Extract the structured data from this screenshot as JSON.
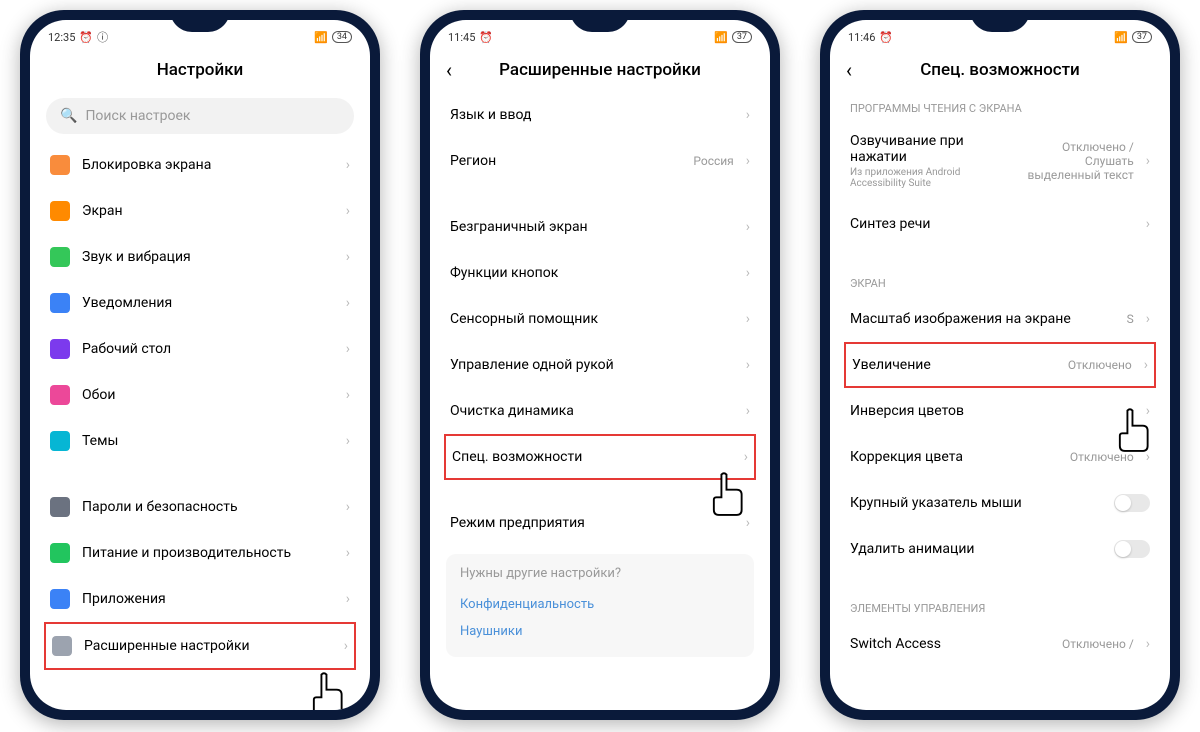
{
  "phone1": {
    "time": "12:35",
    "battery": "34",
    "title": "Настройки",
    "search_placeholder": "Поиск настроек",
    "items": [
      {
        "label": "Блокировка экрана",
        "color": "#f98c3c"
      },
      {
        "label": "Экран",
        "color": "#ff8a00"
      },
      {
        "label": "Звук и вибрация",
        "color": "#34c759"
      },
      {
        "label": "Уведомления",
        "color": "#3b82f6"
      },
      {
        "label": "Рабочий стол",
        "color": "#7c3aed"
      },
      {
        "label": "Обои",
        "color": "#ec4899"
      },
      {
        "label": "Темы",
        "color": "#06b6d4"
      }
    ],
    "items2": [
      {
        "label": "Пароли и безопасность",
        "color": "#6b7280"
      },
      {
        "label": "Питание и производительность",
        "color": "#22c55e"
      },
      {
        "label": "Приложения",
        "color": "#3b82f6"
      },
      {
        "label": "Расширенные настройки",
        "color": "#9ca3af",
        "highlight": true
      }
    ]
  },
  "phone2": {
    "time": "11:45",
    "battery": "37",
    "title": "Расширенные настройки",
    "items": [
      {
        "label": "Язык и ввод"
      },
      {
        "label": "Регион",
        "value": "Россия"
      }
    ],
    "items2": [
      {
        "label": "Безграничный экран"
      },
      {
        "label": "Функции кнопок"
      },
      {
        "label": "Сенсорный помощник"
      },
      {
        "label": "Управление одной рукой"
      },
      {
        "label": "Очистка динамика"
      },
      {
        "label": "Спец. возможности",
        "highlight": true
      }
    ],
    "items3": [
      {
        "label": "Режим предприятия"
      }
    ],
    "footer_q": "Нужны другие настройки?",
    "footer_links": [
      "Конфиденциальность",
      "Наушники"
    ]
  },
  "phone3": {
    "time": "11:46",
    "battery": "37",
    "title": "Спец. возможности",
    "section1": "ПРОГРАММЫ ЧТЕНИЯ С ЭКРАНА",
    "items1": [
      {
        "label": "Озвучивание при нажатии",
        "sub": "Из приложения Android Accessibility Suite",
        "value": "Отключено / Слушать выделенный текст"
      },
      {
        "label": "Синтез речи"
      }
    ],
    "section2": "ЭКРАН",
    "items2": [
      {
        "label": "Масштаб изображения на экране",
        "value": "S"
      },
      {
        "label": "Увеличение",
        "value": "Отключено",
        "highlight": true
      },
      {
        "label": "Инверсия цветов"
      },
      {
        "label": "Коррекция цвета",
        "value": "Отключено"
      },
      {
        "label": "Крупный указатель мыши",
        "toggle": true
      },
      {
        "label": "Удалить анимации",
        "toggle": true
      }
    ],
    "section3": "ЭЛЕМЕНТЫ УПРАВЛЕНИЯ",
    "items3": [
      {
        "label": "Switch Access",
        "value": "Отключено /"
      }
    ]
  }
}
